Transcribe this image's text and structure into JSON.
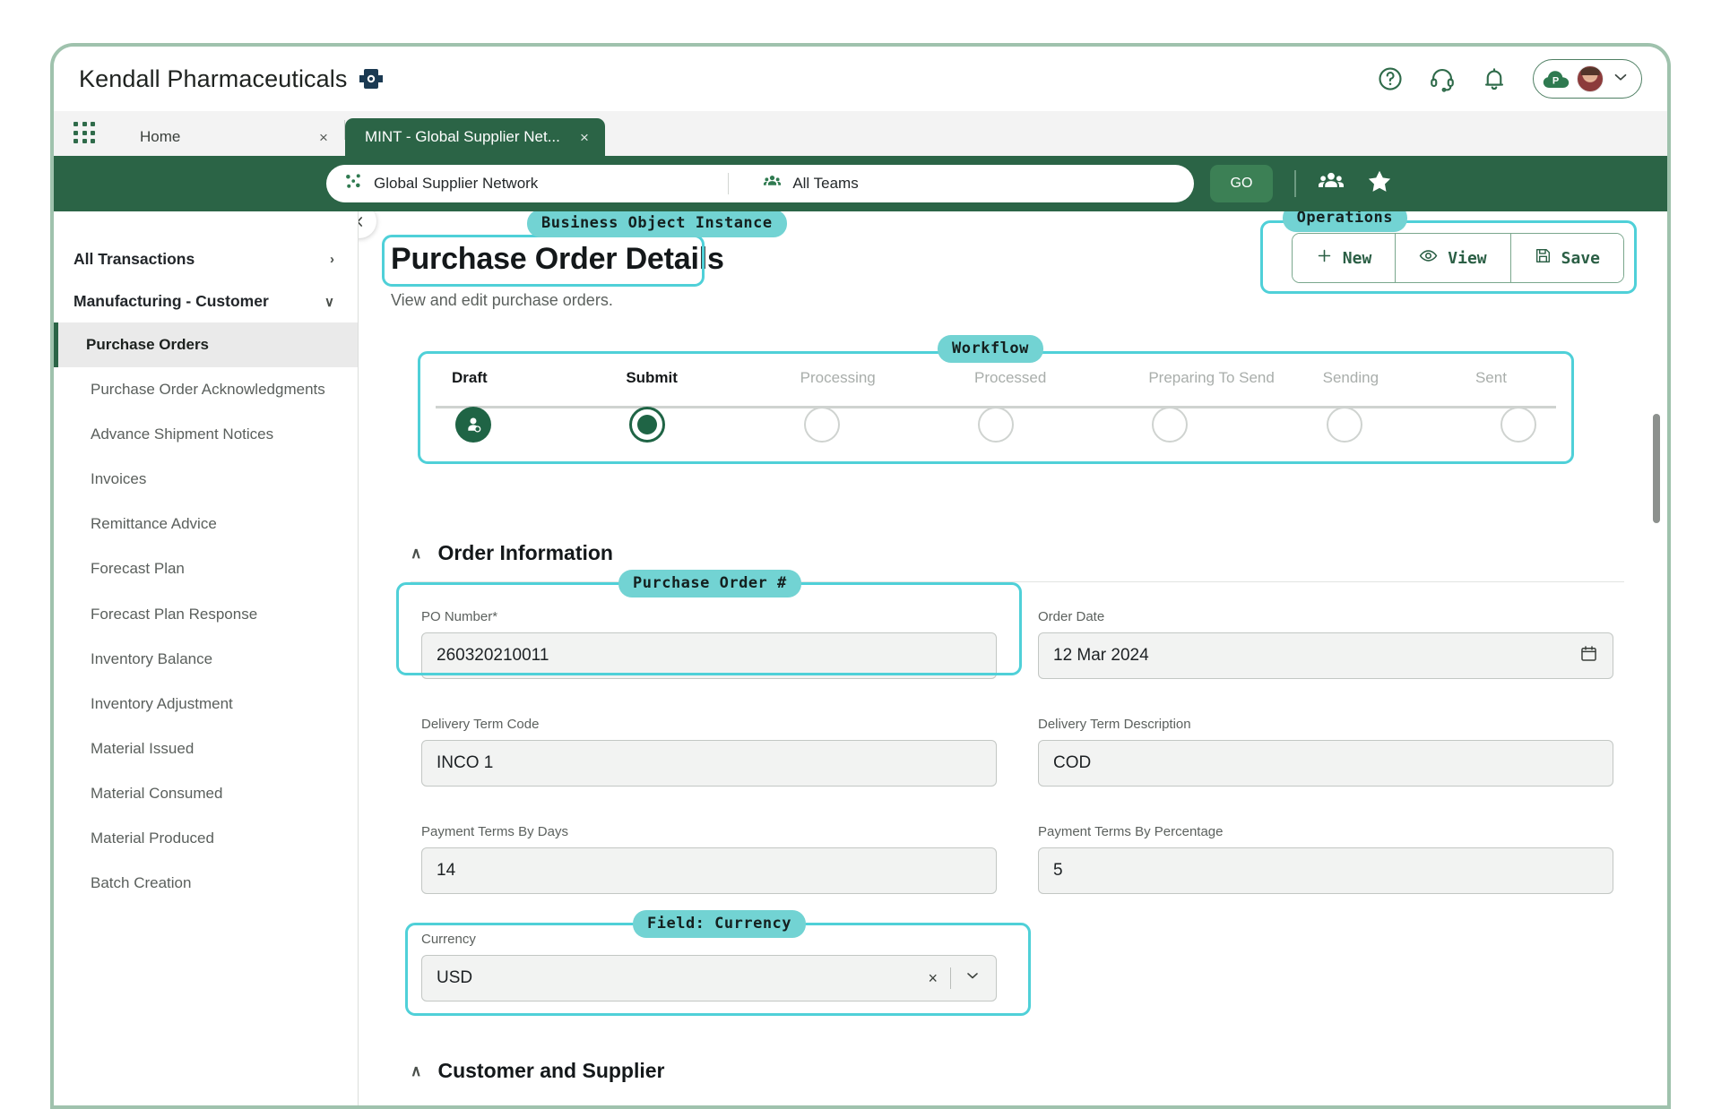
{
  "header": {
    "brand": "Kendall Pharmaceuticals",
    "brand_mark_icon": "network-logo-icon",
    "help_icon": "help-circle-icon",
    "support_icon": "headset-icon",
    "notifications_icon": "bell-icon",
    "cloud_badge_icon": "cloud-p-icon",
    "avatar_icon": "user-avatar",
    "user_menu_chevron": "chevron-down-icon"
  },
  "tabs": {
    "app_grid_icon": "app-grid-icon",
    "items": [
      {
        "label": "Home",
        "active": false,
        "close": "×"
      },
      {
        "label": "MINT - Global Supplier Net...",
        "active": true,
        "close": "×"
      }
    ]
  },
  "searchbar": {
    "context_icon": "network-nodes-icon",
    "context": "Global Supplier Network",
    "team_icon": "team-icon",
    "team": "All Teams",
    "go_label": "GO",
    "people_icon": "people-icon",
    "favorite_icon": "star-icon"
  },
  "sidebar": {
    "collapse_icon": "chevron-left-icon",
    "groups": [
      {
        "label": "All Transactions",
        "chevron": "›"
      },
      {
        "label": "Manufacturing - Customer",
        "chevron": "∨"
      }
    ],
    "items": [
      {
        "label": "Purchase Orders",
        "active": true
      },
      {
        "label": "Purchase Order Acknowledgments",
        "active": false
      },
      {
        "label": "Advance Shipment Notices",
        "active": false
      },
      {
        "label": "Invoices",
        "active": false
      },
      {
        "label": "Remittance Advice",
        "active": false
      },
      {
        "label": "Forecast Plan",
        "active": false
      },
      {
        "label": "Forecast Plan Response",
        "active": false
      },
      {
        "label": "Inventory Balance",
        "active": false
      },
      {
        "label": "Inventory Adjustment",
        "active": false
      },
      {
        "label": "Material Issued",
        "active": false
      },
      {
        "label": "Material Consumed",
        "active": false
      },
      {
        "label": "Material Produced",
        "active": false
      },
      {
        "label": "Batch Creation",
        "active": false
      }
    ]
  },
  "page": {
    "title": "Purchase Order Details",
    "subtitle": "View and edit purchase orders."
  },
  "annotations": {
    "business_object": "Business Object Instance",
    "operations": "Operations",
    "workflow": "Workflow",
    "purchase_order_number": "Purchase Order #",
    "field_currency": "Field: Currency"
  },
  "operations": {
    "new_label": "New",
    "new_icon": "plus-icon",
    "view_label": "View",
    "view_icon": "eye-icon",
    "save_label": "Save",
    "save_icon": "floppy-disk-icon"
  },
  "workflow": {
    "steps": [
      {
        "label": "Draft",
        "state": "done",
        "node": "person"
      },
      {
        "label": "Submit",
        "state": "done",
        "node": "ring"
      },
      {
        "label": "Processing",
        "state": "todo",
        "node": "empty"
      },
      {
        "label": "Processed",
        "state": "todo",
        "node": "empty"
      },
      {
        "label": "Preparing To Send",
        "state": "todo",
        "node": "empty"
      },
      {
        "label": "Sending",
        "state": "todo",
        "node": "empty"
      },
      {
        "label": "Sent",
        "state": "todo",
        "node": "empty"
      }
    ]
  },
  "sections": [
    {
      "title": "Order Information",
      "caret": "∧"
    },
    {
      "title": "Customer and Supplier",
      "caret": "∧"
    }
  ],
  "fields": {
    "po_number": {
      "label": "PO Number*",
      "value": "260320210011"
    },
    "order_date": {
      "label": "Order Date",
      "value": "12 Mar 2024",
      "icon": "calendar-icon"
    },
    "delivery_code": {
      "label": "Delivery Term Code",
      "value": "INCO 1"
    },
    "delivery_desc": {
      "label": "Delivery Term Description",
      "value": "COD"
    },
    "payment_days": {
      "label": "Payment Terms By Days",
      "value": "14"
    },
    "payment_percent": {
      "label": "Payment Terms By Percentage",
      "value": "5"
    },
    "currency": {
      "label": "Currency",
      "value": "USD",
      "clear_icon": "close-icon",
      "dropdown_icon": "chevron-down-icon"
    }
  },
  "colors": {
    "brand_green": "#2b6446",
    "accent_teal": "#4fd0d8",
    "anno_pill": "#72d3d3",
    "frame_sage": "#9fc2ad"
  }
}
